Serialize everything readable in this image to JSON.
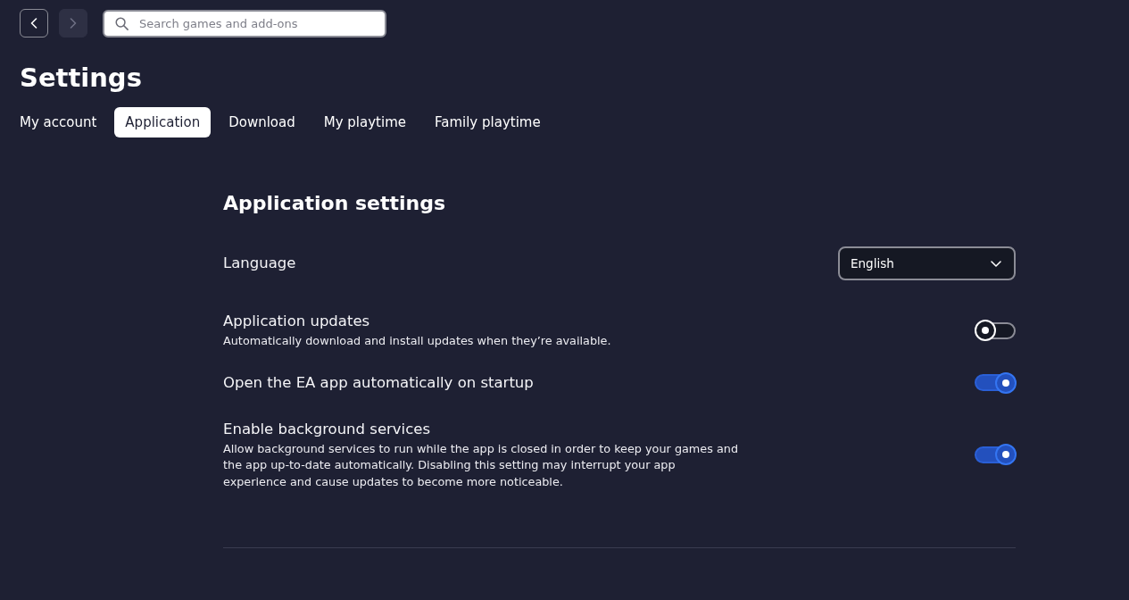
{
  "nav": [
    {
      "kind": "back",
      "disabled": false
    },
    {
      "kind": "forward",
      "disabled": true
    }
  ],
  "search": {
    "placeholder": "Search games and add-ons"
  },
  "page_title": "Settings",
  "tabs": [
    {
      "label": "My account",
      "selected": false
    },
    {
      "label": "Application",
      "selected": true
    },
    {
      "label": "Download",
      "selected": false
    },
    {
      "label": "My playtime",
      "selected": false
    },
    {
      "label": "Family playtime",
      "selected": false
    }
  ],
  "section": {
    "title": "Application settings",
    "settings": [
      {
        "kind": "dropdown",
        "label": "Language",
        "value": "English"
      },
      {
        "kind": "toggle",
        "label": "Application updates",
        "description": "Automatically download and install updates when they’re available.",
        "on": false
      },
      {
        "kind": "toggle",
        "label": "Open the EA app automatically on startup",
        "on": true
      },
      {
        "kind": "toggle",
        "label": "Enable background services",
        "description": "Allow background services to run while the app is closed in order to keep your games and the app up-to-date automatically. Disabling this setting may interrupt your app experience and cause updates to become more noticeable.",
        "on": true
      }
    ]
  }
}
